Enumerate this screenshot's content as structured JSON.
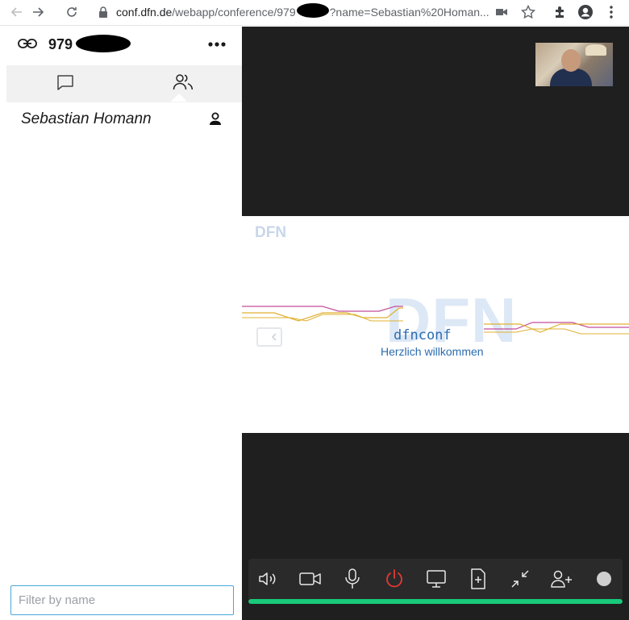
{
  "browser": {
    "url_host": "conf.dfn.de",
    "url_path_start": "/webapp/conference/979",
    "url_path_end": "?name=Sebastian%20Homan..."
  },
  "sidebar": {
    "conference_id": "979",
    "tabs": [
      {
        "name": "chat",
        "icon": "chat-bubble-icon"
      },
      {
        "name": "participants",
        "icon": "participants-icon",
        "active": true
      }
    ],
    "participants": [
      {
        "name": "Sebastian Homann",
        "icon": "user-icon"
      }
    ],
    "filter_placeholder": "Filter by name"
  },
  "slide": {
    "logo_small": "DFN",
    "logo_big": "DFN",
    "product": "dfnconf",
    "welcome": "Herzlich willkommen"
  },
  "controls": {
    "items": [
      "speaker-icon",
      "camera-icon",
      "microphone-icon",
      "hangup-icon",
      "screen-share-icon",
      "add-file-icon",
      "collapse-icon",
      "add-participant-icon",
      "status-dot-icon"
    ],
    "hangup_color": "#e53935",
    "connection_level": 1.0,
    "connection_color": "#18c97a"
  }
}
